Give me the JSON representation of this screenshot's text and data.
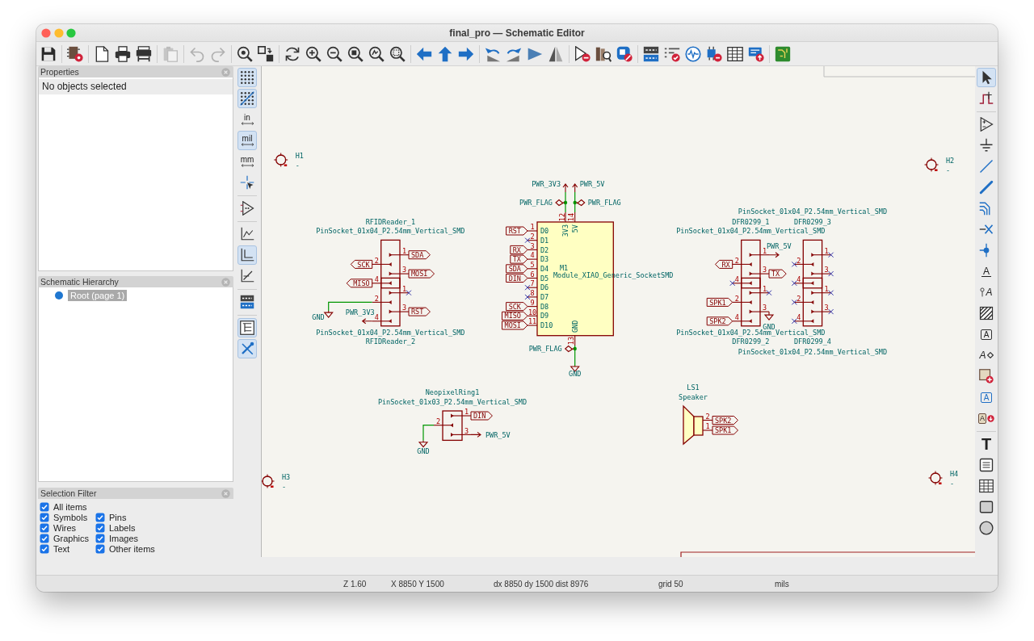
{
  "window": {
    "title": "final_pro — Schematic Editor"
  },
  "toolbar": [
    {
      "disabled": false
    },
    {
      "disabled": false
    },
    {
      "disabled": false
    },
    {
      "disabled": false
    },
    {
      "disabled": false
    },
    {
      "disabled": true
    },
    {
      "disabled": true
    },
    {
      "disabled": true
    },
    {
      "disabled": false
    },
    {
      "disabled": false
    },
    {
      "disabled": false
    },
    {
      "disabled": false
    },
    {
      "disabled": false
    },
    {
      "disabled": false
    },
    {
      "disabled": false
    },
    {
      "disabled": false
    },
    {
      "disabled": false
    },
    {
      "disabled": false
    },
    {
      "disabled": false
    },
    {
      "disabled": false
    },
    {
      "disabled": false
    },
    {
      "disabled": false
    },
    {
      "disabled": false
    },
    {
      "disabled": false
    },
    {
      "disabled": false
    },
    {
      "disabled": false
    },
    {
      "disabled": false
    },
    {
      "disabled": false
    },
    {
      "disabled": false
    },
    {
      "disabled": false
    },
    {
      "disabled": false
    },
    {
      "disabled": false
    },
    {
      "disabled": false
    }
  ],
  "panels": {
    "properties": {
      "title": "Properties",
      "message": "No objects selected"
    },
    "hierarchy": {
      "title": "Schematic Hierarchy",
      "items": [
        {
          "label": "Root (page 1)",
          "selected": true
        }
      ]
    },
    "selection_filter": {
      "title": "Selection Filter",
      "items": [
        {
          "label": "All items",
          "checked": true
        },
        {
          "label": "Symbols",
          "checked": true
        },
        {
          "label": "Pins",
          "checked": true
        },
        {
          "label": "Wires",
          "checked": true
        },
        {
          "label": "Labels",
          "checked": true
        },
        {
          "label": "Graphics",
          "checked": true
        },
        {
          "label": "Images",
          "checked": true
        },
        {
          "label": "Text",
          "checked": true
        },
        {
          "label": "Other items",
          "checked": true
        }
      ]
    }
  },
  "left_toolbar": [
    {
      "on": true
    },
    {
      "on": true
    },
    {
      "text": "in",
      "on": false
    },
    {
      "text": "mil",
      "on": true
    },
    {
      "text": "mm",
      "on": false
    },
    {
      "on": false
    },
    {
      "on": false
    },
    {
      "on": false
    },
    {
      "on": true
    },
    {
      "on": false
    },
    {
      "on": false
    },
    {
      "on": true
    },
    {
      "on": true
    }
  ],
  "right_toolbar": [
    {
      "selected": true
    },
    {
      "selected": false
    },
    {
      "selected": false
    },
    {
      "selected": false
    },
    {
      "selected": false
    },
    {
      "selected": false
    },
    {
      "selected": false
    },
    {
      "selected": false
    },
    {
      "selected": false
    },
    {
      "text": "A",
      "selected": false
    },
    {
      "text": "A",
      "selected": false
    },
    {
      "selected": false
    },
    {
      "text": "A",
      "selected": false
    },
    {
      "text": "A",
      "selected": false
    },
    {
      "selected": false
    },
    {
      "text": "A",
      "selected": false
    },
    {
      "text": "A",
      "selected": false
    },
    {
      "text": "T",
      "selected": false
    },
    {
      "selected": false
    },
    {
      "selected": false
    },
    {
      "selected": false
    },
    {
      "selected": false
    }
  ],
  "schematic": {
    "mounting_holes": [
      {
        "reference": "H1",
        "value": "-"
      },
      {
        "reference": "H2",
        "value": "-"
      },
      {
        "reference": "H3",
        "value": "-"
      },
      {
        "reference": "H4",
        "value": "-"
      }
    ],
    "symbols": [
      {
        "kind": "connector",
        "reference": "RFIDReader_1",
        "value": "PinSocket_01x04_P2.54mm_Vertical_SMD",
        "pins": [
          {
            "number": "1",
            "net": {
              "kind": "label",
              "text": "SDA",
              "inward": false
            }
          },
          {
            "number": "2",
            "net": {
              "kind": "label",
              "text": "SCK",
              "inward": false
            }
          },
          {
            "number": "3",
            "net": {
              "kind": "label",
              "text": "MOSI",
              "inward": false
            }
          },
          {
            "number": "4",
            "net": {
              "kind": "label",
              "text": "MISO",
              "inward": false
            }
          }
        ]
      },
      {
        "kind": "connector",
        "reference": "RFIDReader_2",
        "value": "PinSocket_01x04_P2.54mm_Vertical_SMD",
        "pins": [
          {
            "number": "1",
            "net": {
              "kind": "no_connect"
            }
          },
          {
            "number": "2",
            "net": {
              "kind": "ground",
              "text": "GND"
            }
          },
          {
            "number": "3",
            "net": {
              "kind": "label",
              "text": "RST",
              "inward": false
            }
          },
          {
            "number": "4",
            "net": {
              "kind": "power",
              "text": "PWR_3V3"
            }
          }
        ]
      },
      {
        "kind": "module",
        "reference": "M1",
        "value": "Module_XIAO_Generic_SocketSMD",
        "pins": [
          {
            "number": "1",
            "name": "D0",
            "net": {
              "kind": "label",
              "text": "RST",
              "inward": true
            }
          },
          {
            "number": "2",
            "name": "D1",
            "net": {
              "kind": "no_connect"
            }
          },
          {
            "number": "3",
            "name": "D2",
            "net": {
              "kind": "label",
              "text": "RX",
              "inward": true
            }
          },
          {
            "number": "4",
            "name": "D3",
            "net": {
              "kind": "label",
              "text": "TX",
              "inward": true
            }
          },
          {
            "number": "5",
            "name": "D4",
            "net": {
              "kind": "label",
              "text": "SDA",
              "inward": true
            }
          },
          {
            "number": "6",
            "name": "D5",
            "net": {
              "kind": "label",
              "text": "DIN",
              "inward": true
            }
          },
          {
            "number": "7",
            "name": "D6",
            "net": {
              "kind": "no_connect"
            }
          },
          {
            "number": "8",
            "name": "D7",
            "net": {
              "kind": "no_connect"
            }
          },
          {
            "number": "9",
            "name": "D8",
            "net": {
              "kind": "label",
              "text": "SCK",
              "inward": true
            }
          },
          {
            "number": "10",
            "name": "D9",
            "net": {
              "kind": "label",
              "text": "MISO",
              "inward": true
            }
          },
          {
            "number": "11",
            "name": "D10",
            "net": {
              "kind": "label",
              "text": "MOSI",
              "inward": true
            }
          },
          {
            "number": "12",
            "name": "3V3",
            "net": {
              "kind": "power",
              "text": "PWR_3V3",
              "flag": "PWR_FLAG"
            }
          },
          {
            "number": "14",
            "name": "5V",
            "net": {
              "kind": "power",
              "text": "PWR_5V",
              "flag": "PWR_FLAG"
            }
          },
          {
            "number": "13",
            "name": "GND",
            "net": {
              "kind": "ground",
              "text": "GND",
              "flag": "PWR_FLAG"
            }
          }
        ]
      },
      {
        "kind": "connector",
        "reference": "DFR0299_1",
        "value": "PinSocket_01x04_P2.54mm_Vertical_SMD",
        "pins": [
          {
            "number": "1",
            "net": {
              "kind": "power",
              "text": "PWR_5V"
            }
          },
          {
            "number": "2",
            "net": {
              "kind": "label",
              "text": "RX",
              "inward": false
            }
          },
          {
            "number": "3",
            "net": {
              "kind": "label",
              "text": "TX",
              "inward": false
            }
          },
          {
            "number": "4",
            "net": {
              "kind": "no_connect"
            }
          }
        ]
      },
      {
        "kind": "connector",
        "reference": "DFR0299_3",
        "value": "PinSocket_01x04_P2.54mm_Vertical_SMD",
        "pins": [
          {
            "number": "1",
            "net": {
              "kind": "no_connect"
            }
          },
          {
            "number": "2",
            "net": {
              "kind": "no_connect"
            }
          },
          {
            "number": "3",
            "net": {
              "kind": "no_connect"
            }
          },
          {
            "number": "4",
            "net": {
              "kind": "no_connect"
            }
          }
        ]
      },
      {
        "kind": "connector",
        "reference": "DFR0299_2",
        "value": "PinSocket_01x04_P2.54mm_Vertical_SMD",
        "pins": [
          {
            "number": "1",
            "net": {
              "kind": "no_connect"
            }
          },
          {
            "number": "2",
            "net": {
              "kind": "label",
              "text": "SPK1",
              "inward": true
            }
          },
          {
            "number": "4",
            "net": {
              "kind": "label",
              "text": "SPK2",
              "inward": true
            }
          },
          {
            "number": "3",
            "net": {
              "kind": "ground",
              "text": "GND"
            }
          }
        ]
      },
      {
        "kind": "connector",
        "reference": "DFR0299_4",
        "value": "PinSocket_01x04_P2.54mm_Vertical_SMD",
        "pins": [
          {
            "number": "1",
            "net": {
              "kind": "no_connect"
            }
          },
          {
            "number": "2",
            "net": {
              "kind": "no_connect"
            }
          },
          {
            "number": "3",
            "net": {
              "kind": "no_connect"
            }
          },
          {
            "number": "4",
            "net": {
              "kind": "no_connect"
            }
          }
        ]
      },
      {
        "kind": "connector",
        "reference": "NeopixelRing1",
        "value": "PinSocket_01x03_P2.54mm_Vertical_SMD",
        "pins": [
          {
            "number": "1",
            "net": {
              "kind": "label",
              "text": "DIN",
              "inward": false
            }
          },
          {
            "number": "2",
            "net": {
              "kind": "ground",
              "text": "GND"
            }
          },
          {
            "number": "3",
            "net": {
              "kind": "power",
              "text": "PWR_5V"
            }
          }
        ]
      },
      {
        "kind": "speaker",
        "reference": "LS1",
        "value": "Speaker",
        "pins": [
          {
            "number": "2",
            "net": {
              "kind": "label",
              "text": "SPK2",
              "inward": false
            }
          },
          {
            "number": "1",
            "net": {
              "kind": "label",
              "text": "SPK1",
              "inward": false
            }
          }
        ]
      }
    ]
  },
  "status_bar": {
    "zoom": "Z 1.60",
    "cursor": "X 8850 Y 1500",
    "delta": "dx 8850 dy 1500 dist 8976",
    "grid": "grid 50",
    "units": "mils"
  }
}
